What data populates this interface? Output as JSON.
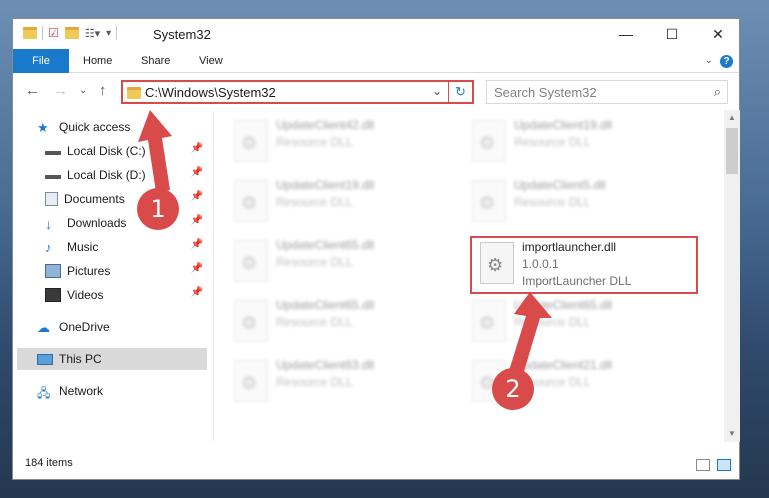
{
  "window": {
    "title": "System32",
    "controls": {
      "minimize": "—",
      "maximize": "☐",
      "close": "✕"
    }
  },
  "ribbon": {
    "tabs": [
      "File",
      "Home",
      "Share",
      "View"
    ],
    "help": "?"
  },
  "address": {
    "path": "C:\\Windows\\System32",
    "search_placeholder": "Search System32"
  },
  "nav": {
    "items": [
      {
        "label": "Quick access",
        "icon": "star-icon"
      },
      {
        "label": "Local Disk (C:)",
        "icon": "drive-icon",
        "pinned": true
      },
      {
        "label": "Local Disk (D:)",
        "icon": "drive-icon",
        "pinned": true
      },
      {
        "label": "Documents",
        "icon": "documents-icon",
        "pinned": true
      },
      {
        "label": "Downloads",
        "icon": "download-icon",
        "pinned": true
      },
      {
        "label": "Music",
        "icon": "music-icon",
        "pinned": true
      },
      {
        "label": "Pictures",
        "icon": "pictures-icon",
        "pinned": true
      },
      {
        "label": "Videos",
        "icon": "videos-icon",
        "pinned": true
      },
      {
        "label": "OneDrive",
        "icon": "cloud-icon"
      },
      {
        "label": "This PC",
        "icon": "computer-icon",
        "selected": true
      },
      {
        "label": "Network",
        "icon": "network-icon"
      }
    ]
  },
  "files": {
    "left": [
      {
        "name": "UpdateClient42.dll",
        "desc": "Resource DLL"
      },
      {
        "name": "UpdateClient19.dll",
        "desc": "Resource DLL"
      },
      {
        "name": "UpdateClient65.dll",
        "desc": "Resource DLL"
      },
      {
        "name": "UpdateClient65.dll",
        "desc": "Resource DLL"
      },
      {
        "name": "UpdateClient63.dll",
        "desc": "Resource DLL"
      }
    ],
    "right": [
      {
        "name": "UpdateClient19.dll",
        "desc": "Resource DLL"
      },
      {
        "name": "UpdateClient5.dll",
        "desc": "Resource DLL"
      },
      {
        "name": "importlauncher.dll",
        "version": "1.0.0.1",
        "desc": "ImportLauncher DLL",
        "highlighted": true
      },
      {
        "name": "UpdateClient65.dll",
        "desc": "Resource DLL"
      },
      {
        "name": "UpdateClient21.dll",
        "desc": "Resource DLL"
      }
    ]
  },
  "status": {
    "item_count": "184 items"
  },
  "callouts": [
    "1",
    "2"
  ],
  "colors": {
    "accent": "#1979ca",
    "highlight": "#d94a4a"
  }
}
